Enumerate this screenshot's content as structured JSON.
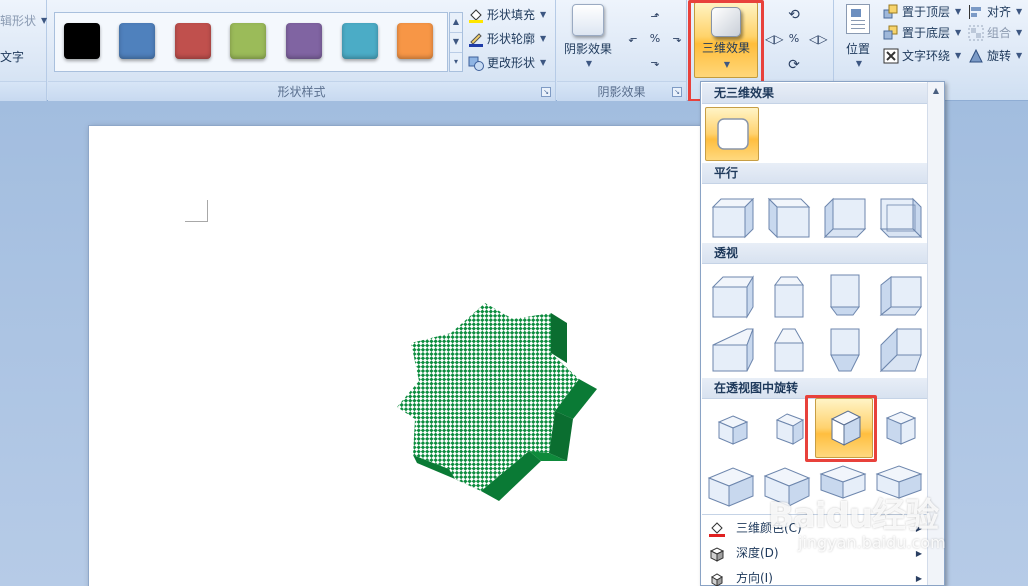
{
  "ribbon": {
    "left_group": {
      "item1": "编辑形状",
      "item2": "加文字"
    },
    "shape_styles": {
      "label": "形状样式",
      "swatches": [
        "#000000",
        "#4f81bd",
        "#c0504d",
        "#9bbb59",
        "#8064a2",
        "#4bacc6",
        "#f79646"
      ],
      "fill": "形状填充",
      "outline": "形状轮廓",
      "change": "更改形状"
    },
    "shadow_effects": {
      "label": "阴影效果",
      "button": "阴影效果"
    },
    "effects_3d": {
      "button": "三维效果"
    },
    "arrange": {
      "position": "位置",
      "bring_front": "置于顶层",
      "send_back": "置于底层",
      "text_wrap": "文字环绕",
      "align": "对齐",
      "group": "组合",
      "rotate": "旋转"
    }
  },
  "dropdown": {
    "sections": [
      "无三维效果",
      "平行",
      "透视",
      "在透视图中旋转"
    ],
    "menu": [
      {
        "label": "三维颜色(C)"
      },
      {
        "label": "深度(D)"
      },
      {
        "label": "方向(I)"
      }
    ]
  },
  "watermark": {
    "logo": "Baidu经验",
    "url": "jingyan.baidu.com"
  },
  "colors": {
    "accent_highlight": "#ffd36b",
    "red_marker": "#e8413b",
    "star_green": "#0a8a3c"
  }
}
